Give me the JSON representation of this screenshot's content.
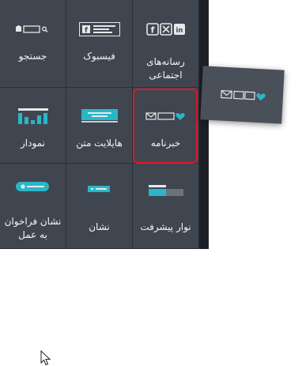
{
  "widgets": {
    "search": {
      "label": "جستجو",
      "icon": "search-icon"
    },
    "facebook": {
      "label": "فیسبوک",
      "icon": "facebook-icon"
    },
    "social": {
      "label_line1": "رسانه‌های",
      "label_line2": "اجتماعی",
      "icon": "social-media-icons"
    },
    "chart": {
      "label": "نمودار",
      "icon": "bar-chart-icon"
    },
    "highlight": {
      "label": "هایلایت متن",
      "icon": "text-highlight-icon"
    },
    "newsletter": {
      "label": "خبرنامه",
      "icon": "newsletter-icon",
      "selected": true
    },
    "cta": {
      "label_line1": "نشان فراخوان",
      "label_line2": "به عمل",
      "icon": "call-to-action-badge-icon"
    },
    "badge": {
      "label": "نشان",
      "icon": "badge-icon"
    },
    "progress": {
      "label": "نوار پیشرفت",
      "icon": "progress-bar-icon"
    }
  },
  "drag_preview": {
    "icon": "newsletter-icon"
  },
  "colors": {
    "panel": "#40464f",
    "accent": "#29b6c8",
    "selection": "#e0162b",
    "icon": "#e6e8ea"
  }
}
